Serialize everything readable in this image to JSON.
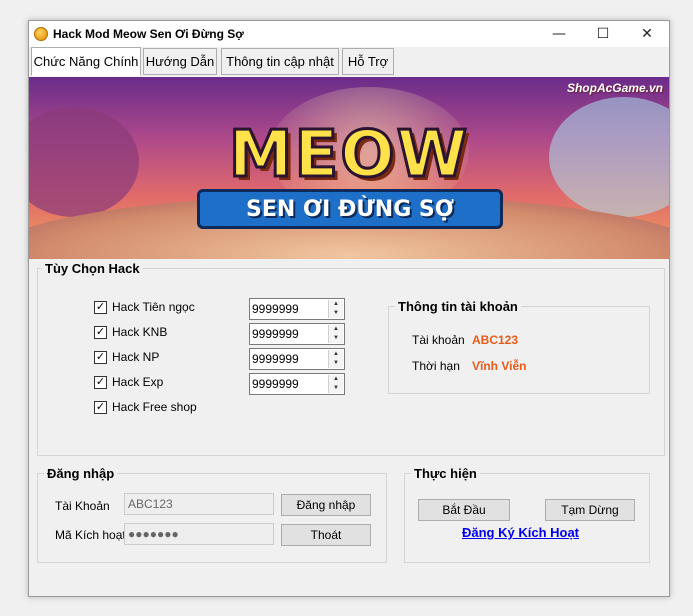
{
  "window": {
    "title": "Hack Mod Meow Sen Ơi Đừng Sợ",
    "controls": {
      "minimize": "—",
      "maximize": "☐",
      "close": "✕"
    }
  },
  "tabs": [
    {
      "label": "Chức Năng Chính",
      "active": true
    },
    {
      "label": "Hướng Dẫn",
      "active": false
    },
    {
      "label": "Thông tin cập nhật",
      "active": false
    },
    {
      "label": "Hỗ Trợ",
      "active": false
    }
  ],
  "banner": {
    "logo_title": "MEOW",
    "logo_subtitle": "SEN ƠI ĐỪNG SỢ",
    "watermark": "ShopAcGame.vn"
  },
  "hack_options": {
    "title": "Tùy Chọn Hack",
    "items": [
      {
        "label": "Hack Tiên ngọc",
        "checked": true,
        "value": "9999999"
      },
      {
        "label": "Hack KNB",
        "checked": true,
        "value": "9999999"
      },
      {
        "label": "Hack NP",
        "checked": true,
        "value": "9999999"
      },
      {
        "label": "Hack Exp",
        "checked": true,
        "value": "9999999"
      },
      {
        "label": "Hack Free shop",
        "checked": true
      }
    ],
    "check_glyph": "✓"
  },
  "account_info": {
    "title": "Thông tin tài khoản",
    "account_label": "Tài khoản",
    "account_value": "ABC123",
    "term_label": "Thời hạn",
    "term_value": "Vĩnh Viễn"
  },
  "login": {
    "title": "Đăng nhập",
    "account_label": "Tài Khoản",
    "account_value": "ABC123",
    "code_label": "Mã Kích hoạt",
    "code_value": "●●●●●●●",
    "login_button": "Đăng nhập",
    "exit_button": "Thoát"
  },
  "actions": {
    "title": "Thực hiện",
    "start_button": "Bắt Đầu",
    "pause_button": "Tạm Dừng",
    "register_link": "Đăng Ký Kích Hoạt"
  },
  "colors": {
    "accent_orange": "#e85a18",
    "link_blue": "#0000ee"
  }
}
